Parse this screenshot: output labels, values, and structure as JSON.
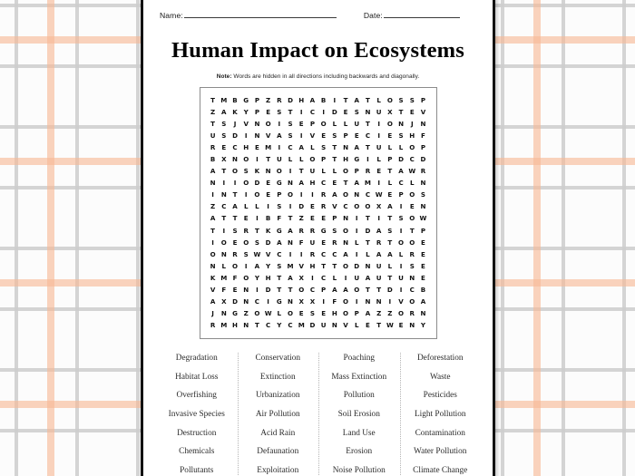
{
  "background": {
    "pattern": "plaid",
    "base_color": "#fcfcfc",
    "line_color_thin": "#cdcdcd",
    "line_color_thick": "#f7b894"
  },
  "page": {
    "border_color": "#121212",
    "background_color": "#ffffff"
  },
  "header": {
    "name_label": "Name:",
    "date_label": "Date:"
  },
  "title": "Human Impact on Ecosystems",
  "note": {
    "strong": "Note:",
    "text": " Words are hidden in all directions including backwards and diagonally."
  },
  "puzzle": {
    "columns": 19,
    "rows": 20,
    "grid": [
      [
        "T",
        "M",
        "B",
        "G",
        "P",
        "Z",
        "R",
        "D",
        "H",
        "A",
        "B",
        "I",
        "T",
        "A",
        "T",
        "L",
        "O",
        "S",
        "S",
        "P"
      ],
      [
        "Z",
        "A",
        "K",
        "Y",
        "P",
        "E",
        "S",
        "T",
        "I",
        "C",
        "I",
        "D",
        "E",
        "S",
        "N",
        "U",
        "X",
        "T",
        "E",
        "V"
      ],
      [
        "T",
        "S",
        "J",
        "V",
        "N",
        "O",
        "I",
        "S",
        "E",
        "P",
        "O",
        "L",
        "L",
        "U",
        "T",
        "I",
        "O",
        "N",
        "J",
        "N"
      ],
      [
        "U",
        "S",
        "D",
        "I",
        "N",
        "V",
        "A",
        "S",
        "I",
        "V",
        "E",
        "S",
        "P",
        "E",
        "C",
        "I",
        "E",
        "S",
        "H",
        "F"
      ],
      [
        "R",
        "E",
        "C",
        "H",
        "E",
        "M",
        "I",
        "C",
        "A",
        "L",
        "S",
        "T",
        "N",
        "A",
        "T",
        "U",
        "L",
        "L",
        "O",
        "P"
      ],
      [
        "B",
        "X",
        "N",
        "O",
        "I",
        "T",
        "U",
        "L",
        "L",
        "O",
        "P",
        "T",
        "H",
        "G",
        "I",
        "L",
        "P",
        "D",
        "C",
        "D"
      ],
      [
        "A",
        "T",
        "O",
        "S",
        "K",
        "N",
        "O",
        "I",
        "T",
        "U",
        "L",
        "L",
        "O",
        "P",
        "R",
        "E",
        "T",
        "A",
        "W",
        "R"
      ],
      [
        "N",
        "I",
        "I",
        "O",
        "D",
        "E",
        "G",
        "N",
        "A",
        "H",
        "C",
        "E",
        "T",
        "A",
        "M",
        "I",
        "L",
        "C",
        "L",
        "N"
      ],
      [
        "I",
        "N",
        "T",
        "I",
        "O",
        "E",
        "P",
        "O",
        "I",
        "I",
        "R",
        "A",
        "O",
        "N",
        "C",
        "W",
        "E",
        "P",
        "O",
        "S"
      ],
      [
        "Z",
        "C",
        "A",
        "L",
        "L",
        "I",
        "S",
        "I",
        "D",
        "E",
        "R",
        "V",
        "C",
        "O",
        "O",
        "X",
        "A",
        "I",
        "E",
        "N"
      ],
      [
        "A",
        "T",
        "T",
        "E",
        "I",
        "B",
        "F",
        "T",
        "Z",
        "E",
        "E",
        "P",
        "N",
        "I",
        "T",
        "I",
        "T",
        "S",
        "O",
        "W"
      ],
      [
        "T",
        "I",
        "S",
        "R",
        "T",
        "K",
        "G",
        "A",
        "R",
        "R",
        "G",
        "S",
        "O",
        "I",
        "D",
        "A",
        "S",
        "I",
        "T",
        "P"
      ],
      [
        "I",
        "O",
        "E",
        "O",
        "S",
        "D",
        "A",
        "N",
        "F",
        "U",
        "E",
        "R",
        "N",
        "L",
        "T",
        "R",
        "T",
        "O",
        "O",
        "E"
      ],
      [
        "O",
        "N",
        "R",
        "S",
        "W",
        "V",
        "C",
        "I",
        "I",
        "R",
        "C",
        "C",
        "A",
        "I",
        "L",
        "A",
        "A",
        "L",
        "R",
        "E"
      ],
      [
        "N",
        "L",
        "O",
        "I",
        "A",
        "Y",
        "S",
        "M",
        "V",
        "H",
        "T",
        "T",
        "O",
        "D",
        "N",
        "U",
        "L",
        "I",
        "S",
        "E"
      ],
      [
        "K",
        "M",
        "F",
        "O",
        "Y",
        "H",
        "T",
        "A",
        "X",
        "I",
        "C",
        "L",
        "I",
        "U",
        "A",
        "U",
        "T",
        "U",
        "N",
        "E"
      ],
      [
        "V",
        "F",
        "E",
        "N",
        "I",
        "D",
        "T",
        "T",
        "O",
        "C",
        "P",
        "A",
        "A",
        "O",
        "T",
        "T",
        "D",
        "I",
        "C",
        "B"
      ],
      [
        "A",
        "X",
        "D",
        "N",
        "C",
        "I",
        "G",
        "N",
        "X",
        "X",
        "I",
        "F",
        "O",
        "I",
        "N",
        "N",
        "I",
        "V",
        "O",
        "A"
      ],
      [
        "J",
        "N",
        "G",
        "Z",
        "O",
        "W",
        "L",
        "O",
        "E",
        "S",
        "E",
        "H",
        "O",
        "P",
        "A",
        "Z",
        "Z",
        "O",
        "R",
        "N"
      ],
      [
        "R",
        "M",
        "H",
        "N",
        "T",
        "C",
        "Y",
        "C",
        "M",
        "D",
        "U",
        "N",
        "V",
        "L",
        "E",
        "T",
        "W",
        "E",
        "N",
        "Y"
      ]
    ]
  },
  "wordlist": {
    "columns": [
      [
        "Degradation",
        "Habitat Loss",
        "Overfishing",
        "Invasive Species",
        "Destruction",
        "Chemicals",
        "Pollutants"
      ],
      [
        "Conservation",
        "Extinction",
        "Urbanization",
        "Air Pollution",
        "Acid Rain",
        "Defaunation",
        "Exploitation"
      ],
      [
        "Poaching",
        "Mass Extinction",
        "Pollution",
        "Soil Erosion",
        "Land Use",
        "Erosion",
        "Noise Pollution"
      ],
      [
        "Deforestation",
        "Waste",
        "Pesticides",
        "Light Pollution",
        "Contamination",
        "Water Pollution",
        "Climate Change"
      ]
    ]
  }
}
